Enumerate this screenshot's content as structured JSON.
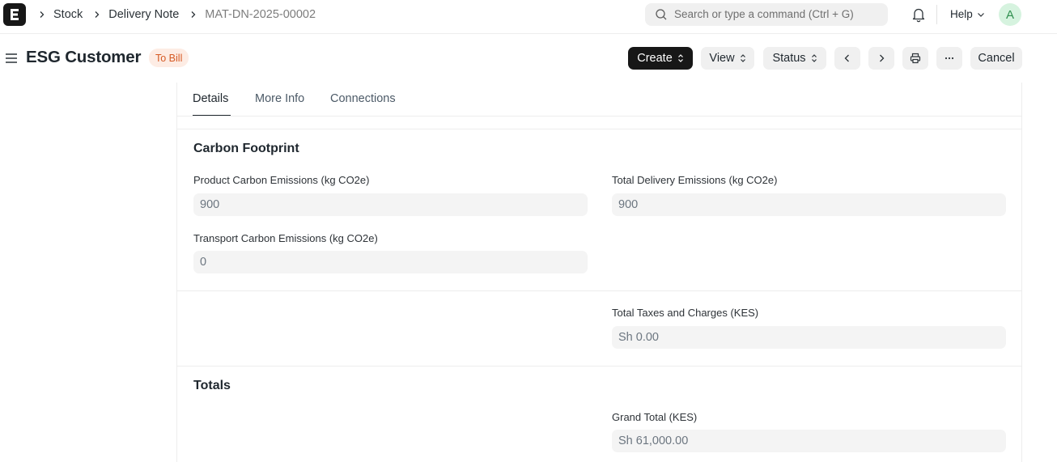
{
  "navbar": {
    "logo_letter": "E",
    "breadcrumbs": [
      "Stock",
      "Delivery Note",
      "MAT-DN-2025-00002"
    ],
    "search_placeholder": "Search or type a command (Ctrl + G)",
    "help_label": "Help",
    "avatar_initial": "A"
  },
  "page": {
    "title": "ESG Customer",
    "status_badge": "To Bill",
    "actions": {
      "create": "Create",
      "view": "View",
      "status": "Status",
      "cancel": "Cancel"
    }
  },
  "tabs": [
    "Details",
    "More Info",
    "Connections"
  ],
  "carbon_footprint": {
    "title": "Carbon Footprint",
    "product_label": "Product Carbon Emissions (kg CO2e)",
    "product_value": "900",
    "total_delivery_label": "Total Delivery Emissions (kg CO2e)",
    "total_delivery_value": "900",
    "transport_label": "Transport Carbon Emissions (kg CO2e)",
    "transport_value": "0"
  },
  "taxes": {
    "total_taxes_label": "Total Taxes and Charges (KES)",
    "total_taxes_value": "Sh 0.00"
  },
  "totals": {
    "title": "Totals",
    "grand_total_label": "Grand Total (KES)",
    "grand_total_value": "Sh 61,000.00"
  },
  "colors": {
    "badge_bg": "#fdece4",
    "badge_text": "#d65a24",
    "primary_button": "#171717"
  }
}
